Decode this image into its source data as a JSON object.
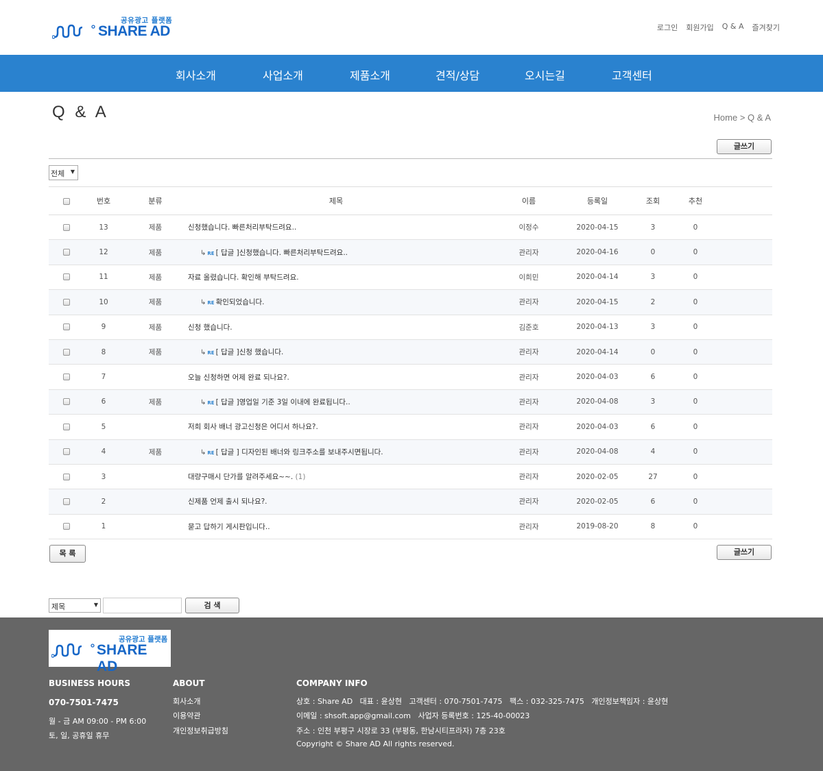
{
  "header": {
    "logo_tag": "공유광고 플랫폼",
    "logo_brand": "SHARE AD",
    "links": [
      "로그인",
      "회원가입",
      "Q & A",
      "즐겨찾기"
    ]
  },
  "nav": [
    "회사소개",
    "사업소개",
    "제품소개",
    "견적/상담",
    "오시는길",
    "고객센터"
  ],
  "page": {
    "title": "Q & A",
    "breadcrumb": "Home > Q & A",
    "write_label": "글쓰기",
    "list_label": "목 록",
    "category_selected": "전체"
  },
  "table": {
    "headers": [
      "번호",
      "분류",
      "제목",
      "이름",
      "등록일",
      "조회",
      "추천"
    ],
    "rows": [
      {
        "no": "13",
        "cat": "제품",
        "subject": "신청했습니다. 빠른처리부탁드려요..",
        "reply": false,
        "name": "이정수",
        "date": "2020-04-15",
        "views": "3",
        "votes": "0"
      },
      {
        "no": "12",
        "cat": "제품",
        "subject": "[ 답글 ]신청했습니다. 빠른처리부탁드려요..",
        "reply": true,
        "name": "관리자",
        "date": "2020-04-16",
        "views": "0",
        "votes": "0"
      },
      {
        "no": "11",
        "cat": "제품",
        "subject": "자료 올렸습니다. 확인해 부탁드려요.",
        "reply": false,
        "name": "이희민",
        "date": "2020-04-14",
        "views": "3",
        "votes": "0"
      },
      {
        "no": "10",
        "cat": "제품",
        "subject": "확인되었습니다.",
        "reply": true,
        "name": "관리자",
        "date": "2020-04-15",
        "views": "2",
        "votes": "0"
      },
      {
        "no": "9",
        "cat": "제품",
        "subject": "신청 했습니다.",
        "reply": false,
        "name": "김준호",
        "date": "2020-04-13",
        "views": "3",
        "votes": "0"
      },
      {
        "no": "8",
        "cat": "제품",
        "subject": "[ 답글 ]신청 했습니다.",
        "reply": true,
        "name": "관리자",
        "date": "2020-04-14",
        "views": "0",
        "votes": "0"
      },
      {
        "no": "7",
        "cat": "",
        "subject": "오늘 신청하면 어제 완료 되나요?.",
        "reply": false,
        "name": "관리자",
        "date": "2020-04-03",
        "views": "6",
        "votes": "0"
      },
      {
        "no": "6",
        "cat": "제품",
        "subject": "[ 답글 ]영업일 기준 3일 이내에 완료됩니다..",
        "reply": true,
        "name": "관리자",
        "date": "2020-04-08",
        "views": "3",
        "votes": "0"
      },
      {
        "no": "5",
        "cat": "",
        "subject": "저희 회사 배너 광고신청은 어디서 하나요?.",
        "reply": false,
        "name": "관리자",
        "date": "2020-04-03",
        "views": "6",
        "votes": "0"
      },
      {
        "no": "4",
        "cat": "제품",
        "subject": "[ 답글 ] 디자인된 배너와 링크주소를 보내주시면됩니다.",
        "reply": true,
        "name": "관리자",
        "date": "2020-04-08",
        "views": "4",
        "votes": "0"
      },
      {
        "no": "3",
        "cat": "",
        "subject": "대량구매시 단가를 알려주세요~~.",
        "comments": "(1)",
        "reply": false,
        "name": "관리자",
        "date": "2020-02-05",
        "views": "27",
        "votes": "0"
      },
      {
        "no": "2",
        "cat": "",
        "subject": "신제품 언제 출시 되나요?.",
        "reply": false,
        "name": "관리자",
        "date": "2020-02-05",
        "views": "6",
        "votes": "0"
      },
      {
        "no": "1",
        "cat": "",
        "subject": "묻고 답하기 게시판입니다..",
        "reply": false,
        "name": "관리자",
        "date": "2019-08-20",
        "views": "8",
        "votes": "0"
      }
    ]
  },
  "search": {
    "field_selected": "제목",
    "button_label": "검 색"
  },
  "footer": {
    "logo_tag": "공유광고 플랫폼",
    "logo_brand": "SHARE AD",
    "hours_title": "BUSINESS HOURS",
    "phone": "070-7501-7475",
    "hours_1": "월 - 금 AM 09:00 - PM 6:00",
    "hours_2": "토, 일, 공휴일 휴무",
    "about_title": "ABOUT",
    "about_links": [
      "회사소개",
      "이용약관",
      "개인정보취급방침"
    ],
    "company_title": "COMPANY INFO",
    "company_lines": [
      "상호 : Share AD   대표 : 윤상현   고객센터 : 070-7501-7475   팩스 : 032-325-7475   개인정보책임자 : 윤상현",
      "이메일 : shsoft.app@gmail.com   사업자 등록번호 : 125-40-00023",
      "주소 : 인천 부평구 시장로 33 (부평동, 한남시티프라자) 7층 23호",
      "Copyright © Share AD All rights reserved."
    ]
  }
}
